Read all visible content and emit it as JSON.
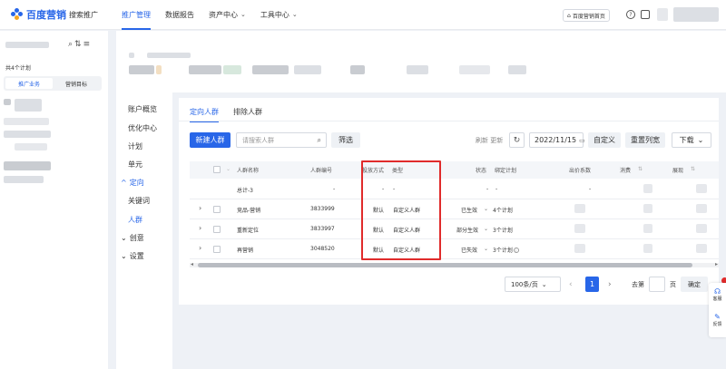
{
  "brand": {
    "logo_text": "百度营销",
    "product": "搜索推广"
  },
  "topnav": [
    {
      "label": "推广管理",
      "active": true,
      "dropdown": false
    },
    {
      "label": "数据报告",
      "active": false,
      "dropdown": false
    },
    {
      "label": "资产中心",
      "active": false,
      "dropdown": true
    },
    {
      "label": "工具中心",
      "active": false,
      "dropdown": true
    }
  ],
  "topbar_right": {
    "home_button": "百度营销首页",
    "help_icon": "?"
  },
  "sidebar": {
    "plan_count": "共4个计划",
    "segments": [
      "推广业务",
      "营销目标"
    ]
  },
  "left_nav": {
    "items": [
      "账户概览",
      "优化中心",
      "计划",
      "单元"
    ],
    "targeting": {
      "label": "定向",
      "children": [
        "关键词",
        "人群"
      ]
    },
    "collapsed": [
      "创意",
      "设置"
    ]
  },
  "tabs": [
    "定向人群",
    "排除人群"
  ],
  "toolbar": {
    "new_button": "新建人群",
    "search_placeholder": "请搜索人群",
    "filter_button": "筛选",
    "refresh_text": "刷新 更新",
    "date": "2022/11/15",
    "custom_button": "自定义",
    "reset_columns_button": "重置列宽",
    "download_button": "下载"
  },
  "table": {
    "headers": [
      "人群名称",
      "人群编号",
      "投放方式",
      "类型",
      "状态",
      "绑定计划",
      "出价系数",
      "消费",
      "展现"
    ],
    "total_row": {
      "name": "总计-3",
      "id": "-",
      "delivery": "-",
      "type": "-",
      "status": "-",
      "plan": "-",
      "bid": "-"
    },
    "rows": [
      {
        "name": "竞品-营销",
        "id": "3833999",
        "delivery": "默认",
        "type": "自定义人群",
        "status": "已生效",
        "plan": "4个计划"
      },
      {
        "name": "重新定位",
        "id": "3833997",
        "delivery": "默认",
        "type": "自定义人群",
        "status": "部分生效",
        "plan": "3个计划"
      },
      {
        "name": "再营销",
        "id": "3048520",
        "delivery": "默认",
        "type": "自定义人群",
        "status": "已失效",
        "plan": "3个计划"
      }
    ]
  },
  "pagination": {
    "page_size": "100条/页",
    "current_page": "1",
    "goto_label": "去第",
    "page_unit": "页",
    "confirm": "确定"
  },
  "float_panel": {
    "items": [
      "客服",
      "反馈"
    ]
  },
  "colors": {
    "accent": "#2866e8",
    "highlight_box": "#e02b2b"
  }
}
